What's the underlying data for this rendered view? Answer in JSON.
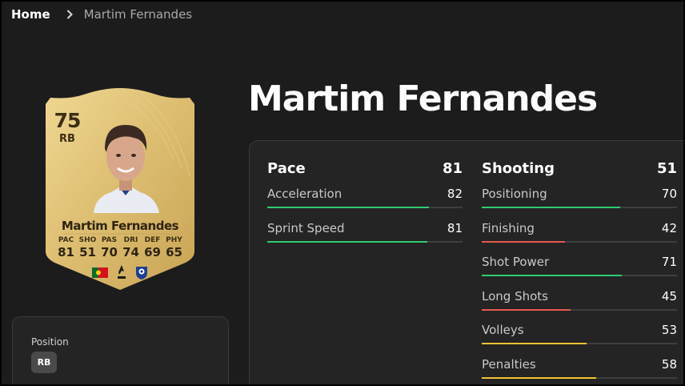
{
  "breadcrumb": {
    "home": "Home",
    "current": "Martim Fernandes"
  },
  "player": {
    "name": "Martim Fernandes"
  },
  "card": {
    "rating": "75",
    "position": "RB",
    "name": "Martim Fernandes",
    "stats": [
      {
        "label": "PAC",
        "value": "81"
      },
      {
        "label": "SHO",
        "value": "51"
      },
      {
        "label": "PAS",
        "value": "70"
      },
      {
        "label": "DRI",
        "value": "74"
      },
      {
        "label": "DEF",
        "value": "69"
      },
      {
        "label": "PHY",
        "value": "65"
      }
    ],
    "badges": [
      "portugal-flag-icon",
      "league-logo-icon",
      "club-crest-icon"
    ]
  },
  "position_panel": {
    "label": "Position",
    "badge": "RB"
  },
  "colors": {
    "background": "#1c1c1c",
    "panel": "#242424",
    "bar_green": "#2ecc71",
    "bar_yellow": "#f1c232",
    "bar_red": "#e8574f",
    "card_gold": "#d9b869"
  },
  "stat_groups": {
    "pace": {
      "title": "Pace",
      "value": "81",
      "items": [
        {
          "name": "Acceleration",
          "value": "82"
        },
        {
          "name": "Sprint Speed",
          "value": "81"
        }
      ]
    },
    "shooting": {
      "title": "Shooting",
      "value": "51",
      "items": [
        {
          "name": "Positioning",
          "value": "70"
        },
        {
          "name": "Finishing",
          "value": "42"
        },
        {
          "name": "Shot Power",
          "value": "71"
        },
        {
          "name": "Long Shots",
          "value": "45"
        },
        {
          "name": "Volleys",
          "value": "53"
        },
        {
          "name": "Penalties",
          "value": "58"
        }
      ]
    }
  }
}
